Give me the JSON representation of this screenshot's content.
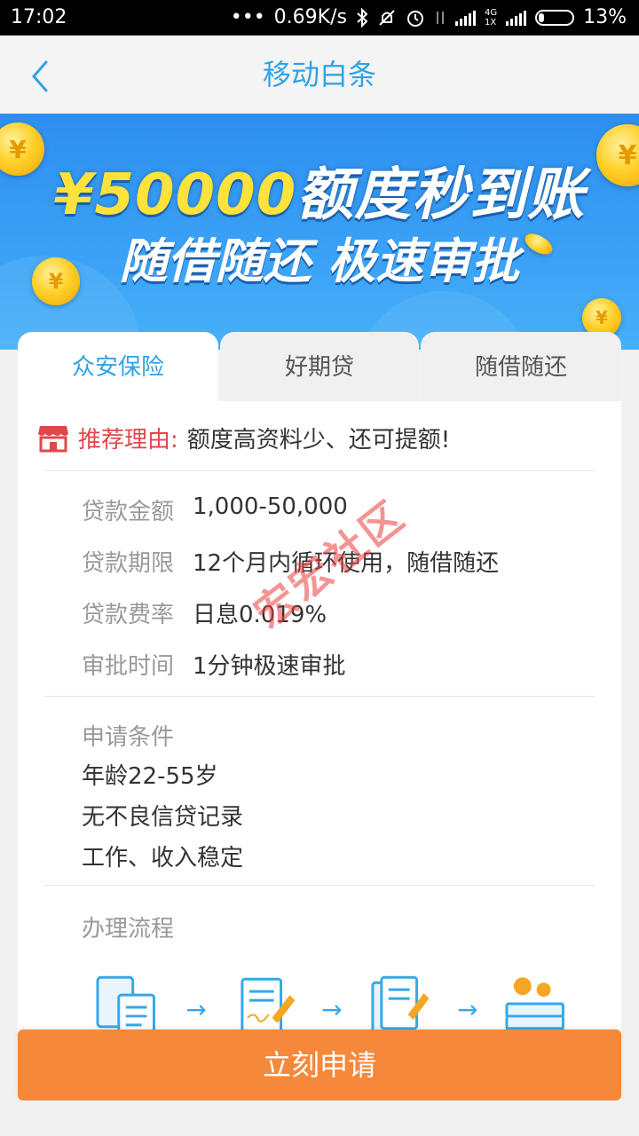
{
  "status_bar": {
    "time": "17:02",
    "dots": "•••",
    "net_speed": "0.69K/s",
    "network_small": "4G\n1X",
    "battery": "13%"
  },
  "header": {
    "back_icon": "chevron-left-icon",
    "title": "移动白条"
  },
  "banner": {
    "amount": "¥50000",
    "line1_rest": "额度秒到账",
    "line2": "随借随还 极速审批"
  },
  "tabs": [
    {
      "label": "众安保险",
      "active": true
    },
    {
      "label": "好期贷",
      "active": false
    },
    {
      "label": "随借随还",
      "active": false
    }
  ],
  "reason": {
    "icon": "store-icon",
    "label": "推荐理由:",
    "text": "额度高资料少、还可提额!"
  },
  "details": [
    {
      "key": "贷款金额",
      "value": "1,000-50,000"
    },
    {
      "key": "贷款期限",
      "value": "12个月内循环使用，随借随还"
    },
    {
      "key": "贷款费率",
      "value": "日息0.019%"
    },
    {
      "key": "审批时间",
      "value": "1分钟极速审批"
    }
  ],
  "conditions": {
    "title": "申请条件",
    "items": [
      "年龄22-55岁",
      "无不良信贷记录",
      "工作、收入稳定"
    ]
  },
  "process": {
    "title": "办理流程",
    "steps": [
      "form-icon",
      "sign-document-icon",
      "document-edit-icon",
      "money-stack-icon"
    ],
    "arrow": "→"
  },
  "watermark": "宏宏社区",
  "apply_button": "立刻申请",
  "colors": {
    "accent_blue": "#2fa3e6",
    "orange": "#f5883a",
    "red": "#e0474b"
  }
}
